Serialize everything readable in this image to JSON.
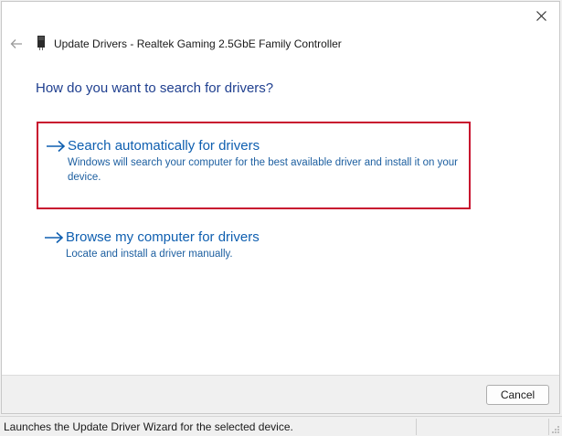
{
  "window": {
    "title": "Update Drivers - Realtek Gaming 2.5GbE Family Controller",
    "close_icon": "close-icon",
    "back_icon": "back-arrow-icon",
    "device_icon": "network-adapter-icon"
  },
  "main": {
    "question": "How do you want to search for drivers?",
    "options": [
      {
        "title": "Search automatically for drivers",
        "description": "Windows will search your computer for the best available driver and install it on your device.",
        "icon": "arrow-right-icon",
        "highlighted": true
      },
      {
        "title": "Browse my computer for drivers",
        "description": "Locate and install a driver manually.",
        "icon": "arrow-right-icon",
        "highlighted": false
      }
    ]
  },
  "footer": {
    "cancel_label": "Cancel"
  },
  "statusbar": {
    "text": "Launches the Update Driver Wizard for the selected device."
  },
  "colors": {
    "link": "#0f5fb0",
    "question": "#1f3f8f",
    "highlight_border": "#c8102e"
  }
}
